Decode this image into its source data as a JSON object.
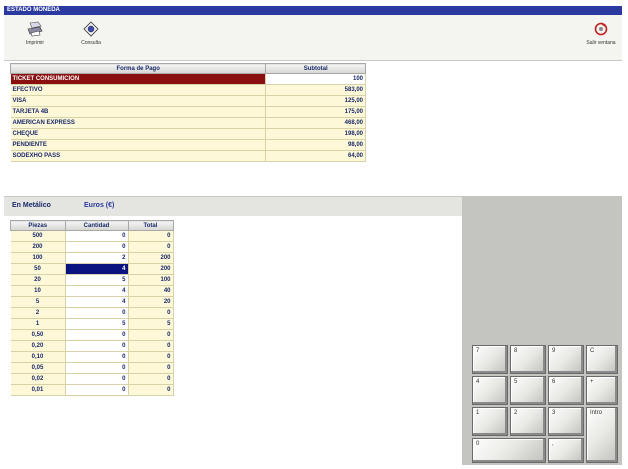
{
  "window": {
    "title": "ESTADO MONEDA"
  },
  "toolbar": {
    "print_label": "Imprimir",
    "query_label": "Consulta",
    "exit_label": "Salir ventana"
  },
  "payments": {
    "headers": [
      "Forma de Pago",
      "Subtotal"
    ],
    "rows": [
      {
        "name": "TICKET CONSUMICION",
        "subtotal": "100"
      },
      {
        "name": "EFECTIVO",
        "subtotal": "583,00"
      },
      {
        "name": "VISA",
        "subtotal": "125,00"
      },
      {
        "name": "TARJETA 4B",
        "subtotal": "175,00"
      },
      {
        "name": "AMERICAN EXPRESS",
        "subtotal": "468,00"
      },
      {
        "name": "CHEQUE",
        "subtotal": "198,00"
      },
      {
        "name": "PENDIENTE",
        "subtotal": "98,00"
      },
      {
        "name": "SODEXHO PASS",
        "subtotal": "64,00"
      }
    ]
  },
  "cash": {
    "label": "En Metálico",
    "currency": "Euros (€)",
    "headers": [
      "Piezas",
      "Cantidad",
      "Total"
    ],
    "rows": [
      {
        "piece": "500",
        "qty": "0",
        "total": "0"
      },
      {
        "piece": "200",
        "qty": "0",
        "total": "0"
      },
      {
        "piece": "100",
        "qty": "2",
        "total": "200"
      },
      {
        "piece": "50",
        "qty": "4",
        "total": "200"
      },
      {
        "piece": "20",
        "qty": "5",
        "total": "100"
      },
      {
        "piece": "10",
        "qty": "4",
        "total": "40"
      },
      {
        "piece": "5",
        "qty": "4",
        "total": "20"
      },
      {
        "piece": "2",
        "qty": "0",
        "total": "0"
      },
      {
        "piece": "1",
        "qty": "5",
        "total": "5"
      },
      {
        "piece": "0,50",
        "qty": "0",
        "total": "0"
      },
      {
        "piece": "0,20",
        "qty": "0",
        "total": "0"
      },
      {
        "piece": "0,10",
        "qty": "0",
        "total": "0"
      },
      {
        "piece": "0,05",
        "qty": "0",
        "total": "0"
      },
      {
        "piece": "0,02",
        "qty": "0",
        "total": "0"
      },
      {
        "piece": "0,01",
        "qty": "0",
        "total": "0"
      }
    ]
  },
  "keypad": {
    "k7": "7",
    "k8": "8",
    "k9": "9",
    "kc": "C",
    "k4": "4",
    "k5": "5",
    "k6": "6",
    "kplus": "+",
    "k1": "1",
    "k2": "2",
    "k3": "3",
    "kintro": "Intro",
    "k0": "0",
    "kdot": ","
  },
  "colors": {
    "title_bar": "#2a3aa0",
    "selected_row": "#8a1010",
    "active_cell": "#0a1480",
    "cell_fill": "#fdf8d8"
  }
}
